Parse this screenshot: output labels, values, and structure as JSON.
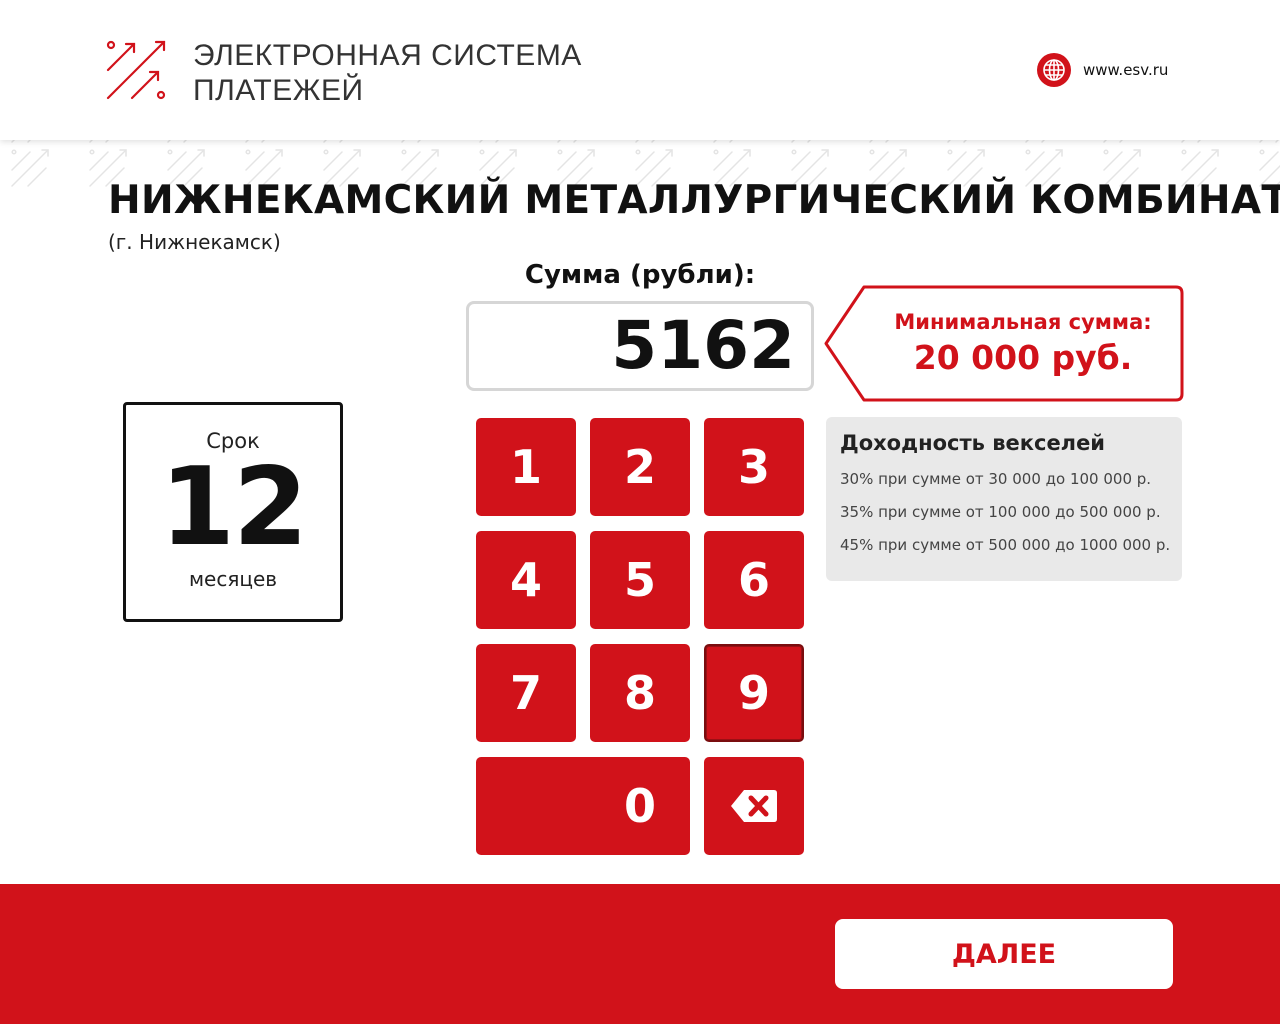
{
  "header": {
    "logo_line1": "ЭЛЕКТРОННАЯ СИСТЕМА",
    "logo_line2": "ПЛАТЕЖЕЙ",
    "website": "www.esv.ru"
  },
  "company": {
    "name": "НИЖНЕКАМСКИЙ МЕТАЛЛУРГИЧЕСКИЙ КОМБИНАТ",
    "city": "(г. Нижнекамск)"
  },
  "term": {
    "label": "Срок",
    "value": "12",
    "unit": "месяцев"
  },
  "sum": {
    "label": "Сумма (рубли):",
    "value": "5162"
  },
  "minimum": {
    "label": "Минимальная сумма:",
    "value": "20 000 руб."
  },
  "yield": {
    "title": "Доходность векселей",
    "rows": [
      "30% при сумме от 30 000 до 100 000 р.",
      "35% при сумме от 100 000 до 500 000 р.",
      "45% при сумме от 500 000 до 1000 000 р."
    ]
  },
  "keypad": {
    "keys": [
      "1",
      "2",
      "3",
      "4",
      "5",
      "6",
      "7",
      "8",
      "9",
      "0"
    ],
    "backspace_icon": "backspace-icon"
  },
  "footer": {
    "next_label": "ДАЛЕЕ"
  },
  "colors": {
    "accent": "#d1121a",
    "panel": "#e9e9e9"
  }
}
